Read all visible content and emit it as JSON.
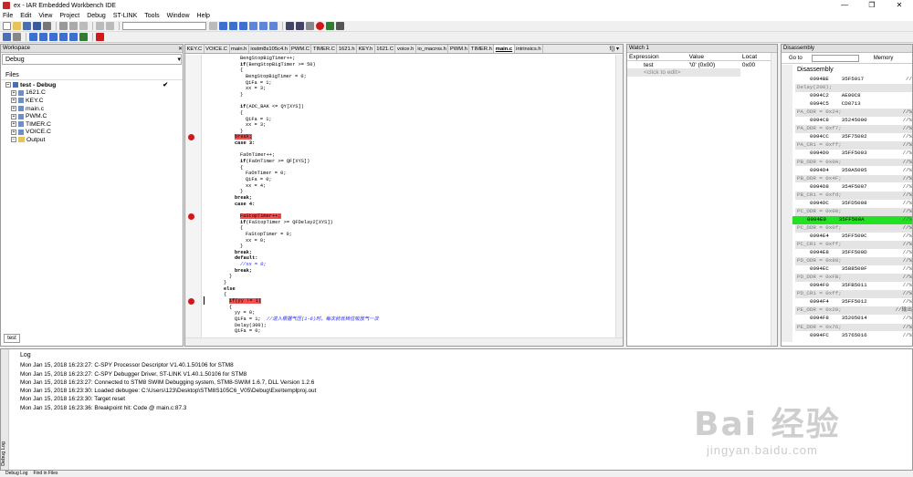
{
  "window": {
    "title": "ex - IAR Embedded Workbench IDE",
    "controls": [
      "—",
      "❐",
      "✕"
    ]
  },
  "menu": [
    "File",
    "Edit",
    "View",
    "Project",
    "Debug",
    "ST-LINK",
    "Tools",
    "Window",
    "Help"
  ],
  "workspace": {
    "header": "Workspace",
    "config": "Debug",
    "files_label": "Files",
    "tree": [
      {
        "label": "test - Debug",
        "kind": "project",
        "check": "✔"
      },
      {
        "label": "1621.C",
        "kind": "file"
      },
      {
        "label": "KEY.C",
        "kind": "file"
      },
      {
        "label": "main.c",
        "kind": "file"
      },
      {
        "label": "PWM.C",
        "kind": "file"
      },
      {
        "label": "TIMER.C",
        "kind": "file"
      },
      {
        "label": "VOICE.C",
        "kind": "file"
      },
      {
        "label": "Output",
        "kind": "folder"
      }
    ],
    "tab": "test"
  },
  "editor": {
    "tabs": [
      "KEY.C",
      "VOICE.C",
      "main.h",
      "iostm8s105c4.h",
      "PWM.C",
      "TIMER.C",
      "1621.h",
      "KEY.h",
      "1621.C",
      "voice.h",
      "io_macros.h",
      "PWM.h",
      "TIMER.h",
      "main.c",
      "intrinsics.h"
    ],
    "active_tab": "main.c",
    "func_label": "f() ▾",
    "lines": [
      {
        "indent": 34,
        "text": "BengStopBigTimer++;",
        "style": ""
      },
      {
        "indent": 34,
        "text": "if(BengStopBigTimer >= 50)",
        "style": "if"
      },
      {
        "indent": 34,
        "text": "{",
        "style": ""
      },
      {
        "indent": 40,
        "text": "BengStopBigTimer = 0;",
        "style": ""
      },
      {
        "indent": 40,
        "text": "QiFa = 1;",
        "style": ""
      },
      {
        "indent": 40,
        "text": "xx = 3;",
        "style": ""
      },
      {
        "indent": 34,
        "text": "}",
        "style": ""
      },
      {
        "indent": 34,
        "text": "",
        "style": ""
      },
      {
        "indent": 34,
        "text": "if(ADC_BAK <= QY[XYS])",
        "style": "if"
      },
      {
        "indent": 34,
        "text": "{",
        "style": ""
      },
      {
        "indent": 40,
        "text": "QiFa = 1;",
        "style": ""
      },
      {
        "indent": 40,
        "text": "xx = 3;",
        "style": ""
      },
      {
        "indent": 34,
        "text": "}",
        "style": ""
      },
      {
        "indent": 28,
        "text": "break;",
        "style": "bp-hl"
      },
      {
        "indent": 28,
        "text": "case 3:",
        "style": "kw"
      },
      {
        "indent": 28,
        "text": "",
        "style": ""
      },
      {
        "indent": 34,
        "text": "FaOnTimer++;",
        "style": ""
      },
      {
        "indent": 34,
        "text": "if(FaOnTimer >= QF[XYS])",
        "style": "if"
      },
      {
        "indent": 34,
        "text": "{",
        "style": ""
      },
      {
        "indent": 40,
        "text": "FaOnTimer = 0;",
        "style": ""
      },
      {
        "indent": 40,
        "text": "QiFa = 0;",
        "style": ""
      },
      {
        "indent": 40,
        "text": "xx = 4;",
        "style": ""
      },
      {
        "indent": 34,
        "text": "}",
        "style": ""
      },
      {
        "indent": 28,
        "text": "break;",
        "style": "kw"
      },
      {
        "indent": 28,
        "text": "case 4:",
        "style": "kw"
      },
      {
        "indent": 28,
        "text": "",
        "style": ""
      },
      {
        "indent": 34,
        "text": "FaStopTimer++;",
        "style": "bp-hl"
      },
      {
        "indent": 34,
        "text": "if(FaStopTimer >= QFDelay2[XYS])",
        "style": "if"
      },
      {
        "indent": 34,
        "text": "{",
        "style": ""
      },
      {
        "indent": 40,
        "text": "FaStopTimer = 0;",
        "style": ""
      },
      {
        "indent": 40,
        "text": "xx = 0;",
        "style": ""
      },
      {
        "indent": 34,
        "text": "}",
        "style": ""
      },
      {
        "indent": 28,
        "text": "break;",
        "style": "kw"
      },
      {
        "indent": 28,
        "text": "default:",
        "style": "kw"
      },
      {
        "indent": 34,
        "text": "//xx = 0;",
        "style": "cm"
      },
      {
        "indent": 28,
        "text": "break;",
        "style": "kw"
      },
      {
        "indent": 22,
        "text": "}",
        "style": ""
      },
      {
        "indent": 16,
        "text": "}",
        "style": ""
      },
      {
        "indent": 16,
        "text": "else",
        "style": "kw"
      },
      {
        "indent": 16,
        "text": "{",
        "style": ""
      },
      {
        "indent": 22,
        "text": "if(yy != 1)",
        "style": "bp-hl"
      },
      {
        "indent": 22,
        "text": "{",
        "style": ""
      },
      {
        "indent": 28,
        "text": "yy = 0;",
        "style": ""
      },
      {
        "indent": 28,
        "text": "QiFa = 1;",
        "style": "",
        "comment": "//进入根据气压(1-6)时，每次就低档位吸放气一次"
      },
      {
        "indent": 28,
        "text": "Delay(300);",
        "style": ""
      },
      {
        "indent": 28,
        "text": "QiFa = 0;",
        "style": ""
      }
    ]
  },
  "watch": {
    "header": "Watch 1",
    "columns": [
      "Expression",
      "Value",
      "Locat"
    ],
    "rows": [
      {
        "expr": "test",
        "value": "'\\0' (0x00)",
        "loc": "0x00"
      }
    ],
    "add_hint": "<click to edit>"
  },
  "disassembly": {
    "header": "Disassembly",
    "goto_label": "Go to",
    "memory_label": "Memory",
    "title": "Disassembly",
    "lines": [
      {
        "text": "0094BE    35F5017",
        "kind": "code",
        "tail": "//"
      },
      {
        "text": "Delay(200);",
        "kind": "src"
      },
      {
        "text": "0094C2    AE00C8",
        "kind": "code",
        "tail": ""
      },
      {
        "text": "0094C5    CD0713",
        "kind": "code",
        "tail": ""
      },
      {
        "text": "PA_ODR = 0x24;",
        "kind": "src",
        "tail": "//%"
      },
      {
        "text": "0094C8    35245000",
        "kind": "code",
        "tail": "//%"
      },
      {
        "text": "PA_DDR = 0xf7;",
        "kind": "src",
        "tail": "//%"
      },
      {
        "text": "0094CC    35F75002",
        "kind": "code",
        "tail": "//%"
      },
      {
        "text": "PA_CR1 = 0xff;",
        "kind": "src",
        "tail": "//%"
      },
      {
        "text": "0094D0    35FF5003",
        "kind": "code",
        "tail": "//%"
      },
      {
        "text": "PB_ODR = 0x0A;",
        "kind": "src",
        "tail": "//%"
      },
      {
        "text": "0094D4    350A5005",
        "kind": "code",
        "tail": "//%"
      },
      {
        "text": "PB_DDR = 0x4F;",
        "kind": "src",
        "tail": "//%"
      },
      {
        "text": "0094D8    354F5007",
        "kind": "code",
        "tail": "//%"
      },
      {
        "text": "PB_CR1 = 0xfd;",
        "kind": "src",
        "tail": "//%"
      },
      {
        "text": "0094DC    35FD5008",
        "kind": "code",
        "tail": "//%"
      },
      {
        "text": "PC_ODR = 0x00;",
        "kind": "src",
        "tail": "//%"
      },
      {
        "text": "0094E0    35FF500A",
        "kind": "cur",
        "tail": "//%"
      },
      {
        "text": "PC_DDR = 0x0f;",
        "kind": "src",
        "tail": "//%"
      },
      {
        "text": "0094E4    35FF500C",
        "kind": "code",
        "tail": "//%"
      },
      {
        "text": "PC_CR1 = 0xff;",
        "kind": "src",
        "tail": "//%"
      },
      {
        "text": "0094E8    35FF500D",
        "kind": "code",
        "tail": "//%"
      },
      {
        "text": "PD_ODR = 0x88;",
        "kind": "src",
        "tail": "//%"
      },
      {
        "text": "0094EC    3588500F",
        "kind": "code",
        "tail": "//%"
      },
      {
        "text": "PD_DDR = 0xFB;",
        "kind": "src",
        "tail": "//%"
      },
      {
        "text": "0094F0    35FB5011",
        "kind": "code",
        "tail": "//%"
      },
      {
        "text": "PD_CR1 = 0xff;",
        "kind": "src",
        "tail": "//%"
      },
      {
        "text": "0094F4    35FF5012",
        "kind": "code",
        "tail": "//%"
      },
      {
        "text": "PE_ODR = 0x20;",
        "kind": "src",
        "tail": "//输出"
      },
      {
        "text": "0094F8    35205014",
        "kind": "code",
        "tail": "//%"
      },
      {
        "text": "PE_DDR = 0x76;",
        "kind": "src",
        "tail": "//%"
      },
      {
        "text": "0094FC    35765016",
        "kind": "code",
        "tail": "//%"
      }
    ]
  },
  "log": {
    "title": "Log",
    "side_label": "Debug Log",
    "lines": [
      "Mon Jan 15, 2018 16:23:27: C-SPY Processor Descriptor V1.40.1.50106 for STM8",
      "Mon Jan 15, 2018 16:23:27: C-SPY Debugger Driver, ST-LINK V1.40.1.50106 for STM8",
      "Mon Jan 15, 2018 16:23:27: Connected to STM8 SWIM Debugging system, STM8-SWIM 1.6.7, DLL Version 1.2.6",
      "Mon Jan 15, 2018 16:23:30: Loaded debugee: C:\\Users\\123\\Desktop\\STM8S105C6_V05\\Debug\\Exe\\templproj.out",
      "Mon Jan 15, 2018 16:23:30: Target reset",
      "Mon Jan 15, 2018 16:23:36: Breakpoint hit: Code @ main.c:87.3"
    ]
  },
  "bottom_tabs": [
    "Debug Log",
    "Find in Files"
  ],
  "watermark": {
    "main": "Bai 经验",
    "sub": "jingyan.baidu.com"
  }
}
